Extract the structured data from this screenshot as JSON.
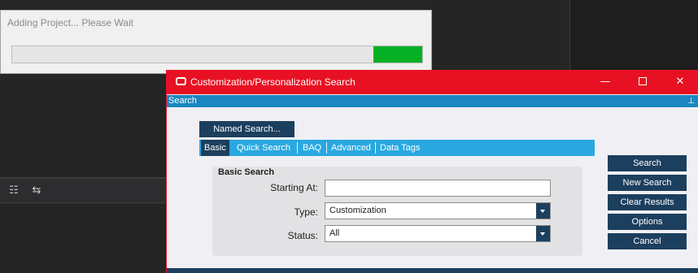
{
  "ide": {
    "toolbar_icons": [
      "list-indent-icon",
      "swap-rows-icon"
    ]
  },
  "progress_dialog": {
    "title": "Adding Project... Please Wait",
    "progress_fraction": 0.12,
    "bar_color": "#06b025"
  },
  "search_window": {
    "title": "Customization/Personalization Search",
    "title_bar_color": "#e81123",
    "panel_header": "Search",
    "controls": {
      "minimize_icon": "minimize-icon",
      "maximize_icon": "maximize-icon",
      "close_icon": "close-icon"
    },
    "named_search_label": "Named Search...",
    "tabs": [
      {
        "label": "Basic",
        "active": true
      },
      {
        "label": "Quick Search",
        "active": false
      },
      {
        "label": "BAQ",
        "active": false
      },
      {
        "label": "Advanced",
        "active": false
      },
      {
        "label": "Data Tags",
        "active": false
      }
    ],
    "basic_search": {
      "group_title": "Basic Search",
      "starting_at_label": "Starting At:",
      "starting_at_value": "",
      "type_label": "Type:",
      "type_value": "Customization",
      "status_label": "Status:",
      "status_value": "All"
    },
    "buttons": {
      "search": "Search",
      "new_search": "New Search",
      "clear_results": "Clear Results",
      "options": "Options",
      "cancel": "Cancel"
    },
    "colors": {
      "dark_blue": "#1c3f5e",
      "tab_blue": "#29a8e0",
      "header_blue": "#1b87c0"
    }
  }
}
